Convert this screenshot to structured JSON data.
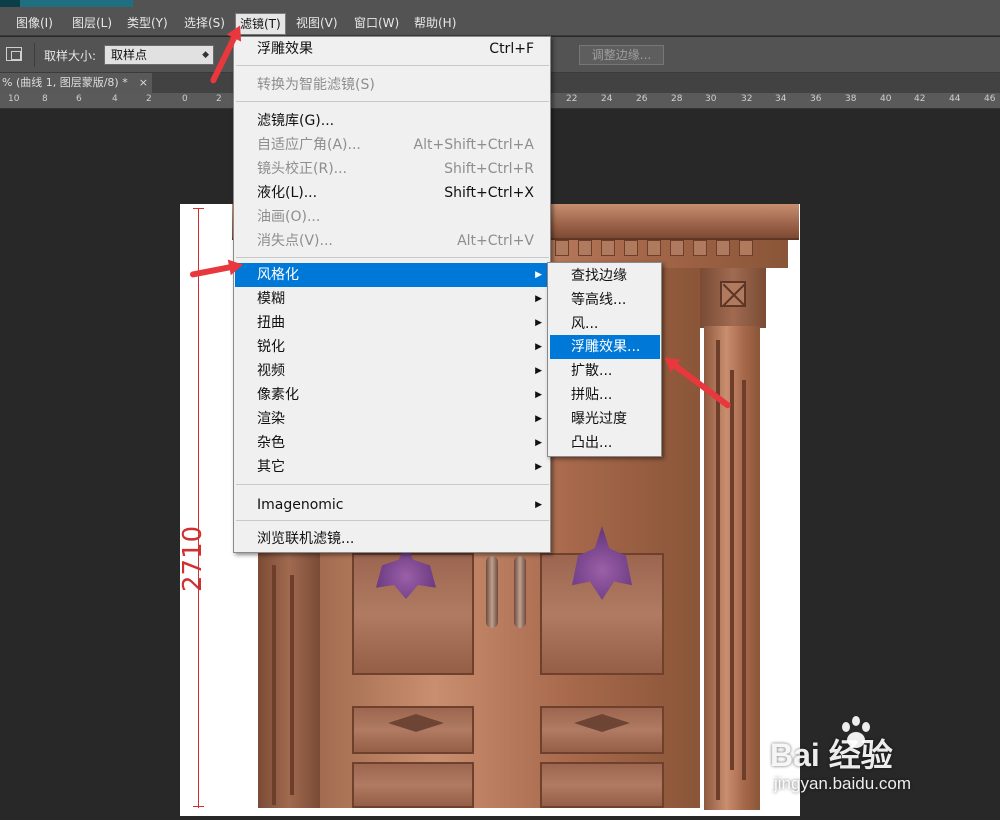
{
  "menubar": {
    "items": [
      "图像(I)",
      "图层(L)",
      "类型(Y)",
      "选择(S)",
      "滤镜(T)",
      "视图(V)",
      "窗口(W)",
      "帮助(H)"
    ],
    "active": "滤镜(T)"
  },
  "options": {
    "sample_size_label": "取样大小:",
    "sample_size_value": "取样点",
    "refine_edge_label": "调整边缘..."
  },
  "doc_tab": {
    "title": "% (曲线 1, 图层蒙版/8) *",
    "close": "×"
  },
  "ruler": {
    "labels": [
      "10",
      "8",
      "6",
      "4",
      "2",
      "0",
      "2",
      "22",
      "24",
      "26",
      "28",
      "30",
      "32",
      "34",
      "36",
      "38",
      "40",
      "42",
      "44",
      "46"
    ]
  },
  "canvas": {
    "dimension_label": "2710"
  },
  "filter_menu": {
    "items": [
      {
        "label": "浮雕效果",
        "shortcut": "Ctrl+F",
        "disabled": false
      },
      {
        "label": "转换为智能滤镜(S)",
        "shortcut": "",
        "disabled": true
      },
      {
        "label": "滤镜库(G)...",
        "shortcut": "",
        "disabled": false
      },
      {
        "label": "自适应广角(A)...",
        "shortcut": "Alt+Shift+Ctrl+A",
        "disabled": true
      },
      {
        "label": "镜头校正(R)...",
        "shortcut": "Shift+Ctrl+R",
        "disabled": true
      },
      {
        "label": "液化(L)...",
        "shortcut": "Shift+Ctrl+X",
        "disabled": false
      },
      {
        "label": "油画(O)...",
        "shortcut": "",
        "disabled": true
      },
      {
        "label": "消失点(V)...",
        "shortcut": "Alt+Ctrl+V",
        "disabled": true
      },
      {
        "label": "风格化",
        "submenu": true,
        "highlight": true
      },
      {
        "label": "模糊",
        "submenu": true
      },
      {
        "label": "扭曲",
        "submenu": true
      },
      {
        "label": "锐化",
        "submenu": true
      },
      {
        "label": "视频",
        "submenu": true
      },
      {
        "label": "像素化",
        "submenu": true
      },
      {
        "label": "渲染",
        "submenu": true
      },
      {
        "label": "杂色",
        "submenu": true
      },
      {
        "label": "其它",
        "submenu": true
      },
      {
        "label": "Imagenomic",
        "submenu": true
      },
      {
        "label": "浏览联机滤镜...",
        "shortcut": ""
      }
    ]
  },
  "stylize_submenu": {
    "items": [
      "查找边缘",
      "等高线...",
      "风...",
      "浮雕效果...",
      "扩散...",
      "拼贴...",
      "曝光过度",
      "凸出..."
    ],
    "highlighted": "浮雕效果..."
  },
  "colors": {
    "menu_highlight": "#0078d7",
    "annotation_arrow": "#e8383d"
  },
  "watermark": {
    "brand": "Bai  经验",
    "url": "jingyan.baidu.com"
  }
}
